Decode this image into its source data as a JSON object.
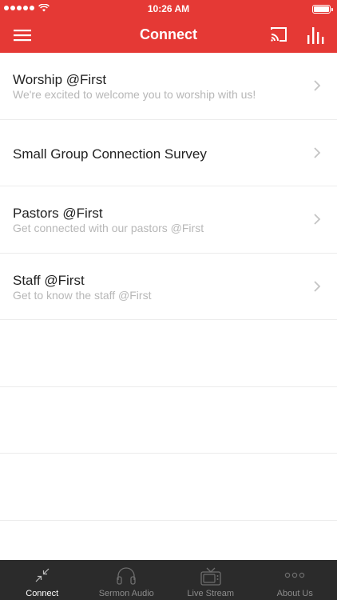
{
  "status_bar": {
    "time": "10:26 AM"
  },
  "nav": {
    "title": "Connect"
  },
  "list": [
    {
      "title": "Worship @First",
      "subtitle": "We're excited to welcome you to worship with us!"
    },
    {
      "title": "Small Group Connection Survey",
      "subtitle": ""
    },
    {
      "title": "Pastors @First",
      "subtitle": "Get connected with our pastors @First"
    },
    {
      "title": "Staff @First",
      "subtitle": "Get to know the staff @First"
    }
  ],
  "tabs": [
    {
      "label": "Connect",
      "icon": "connect-arrows-icon",
      "active": true
    },
    {
      "label": "Sermon Audio",
      "icon": "headphones-icon",
      "active": false
    },
    {
      "label": "Live Stream",
      "icon": "tv-icon",
      "active": false
    },
    {
      "label": "About Us",
      "icon": "more-dots-icon",
      "active": false
    }
  ],
  "colors": {
    "brand": "#e53935",
    "tabbar": "#2b2b2b",
    "subtitle": "#b7b7b7"
  }
}
